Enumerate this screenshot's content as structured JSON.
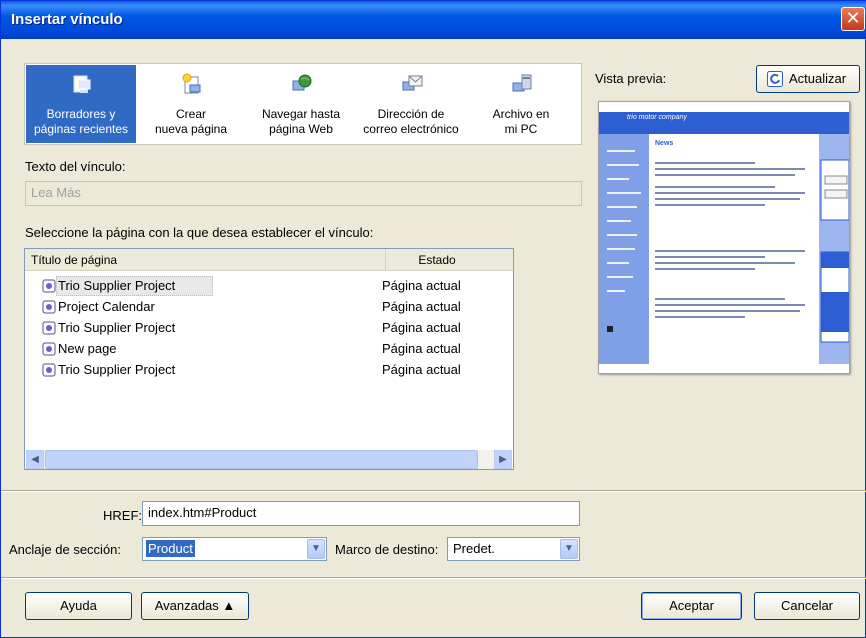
{
  "window": {
    "title": "Insertar vínculo",
    "close_glyph": "✕"
  },
  "link_types": [
    {
      "line1": "Borradores y",
      "line2": "páginas recientes",
      "icon": "drafts-recent-pages-icon",
      "active": true
    },
    {
      "line1": "Crear",
      "line2": "nueva página",
      "icon": "create-new-page-icon",
      "active": false
    },
    {
      "line1": "Navegar hasta",
      "line2": "página Web",
      "icon": "browse-web-page-icon",
      "active": false
    },
    {
      "line1": "Dirección de",
      "line2": "correo electrónico",
      "icon": "email-address-icon",
      "active": false
    },
    {
      "line1": "Archivo en",
      "line2": "mi PC",
      "icon": "file-on-my-pc-icon",
      "active": false
    }
  ],
  "link_text": {
    "label": "Texto del vínculo:",
    "value": "Lea Más"
  },
  "page_select_label": "Seleccione la página con la que desea establecer el vínculo:",
  "table": {
    "headers": [
      "Título de página",
      "Estado"
    ],
    "rows": [
      {
        "title": "Trio Supplier Project",
        "status": "Página actual"
      },
      {
        "title": "Project Calendar",
        "status": "Página actual"
      },
      {
        "title": "Trio Supplier Project",
        "status": "Página actual"
      },
      {
        "title": "New page",
        "status": "Página actual"
      },
      {
        "title": "Trio Supplier Project",
        "status": "Página actual"
      }
    ]
  },
  "preview": {
    "label": "Vista previa:",
    "refresh_label": "Actualizar",
    "site_name": "trio motor company",
    "news_heading": "News"
  },
  "href": {
    "label": "HREF:",
    "value": "index.htm#Product"
  },
  "anchor": {
    "label": "Anclaje de sección:",
    "value": "Product"
  },
  "target": {
    "label": "Marco de destino:",
    "value": "Predet."
  },
  "buttons": {
    "help": "Ayuda",
    "advanced": "Avanzadas ▲",
    "ok": "Aceptar",
    "cancel": "Cancelar"
  },
  "colors": {
    "accent": "#316ac5",
    "titlebar": "#0058e6",
    "preview_blue": "#2d5fd3"
  }
}
